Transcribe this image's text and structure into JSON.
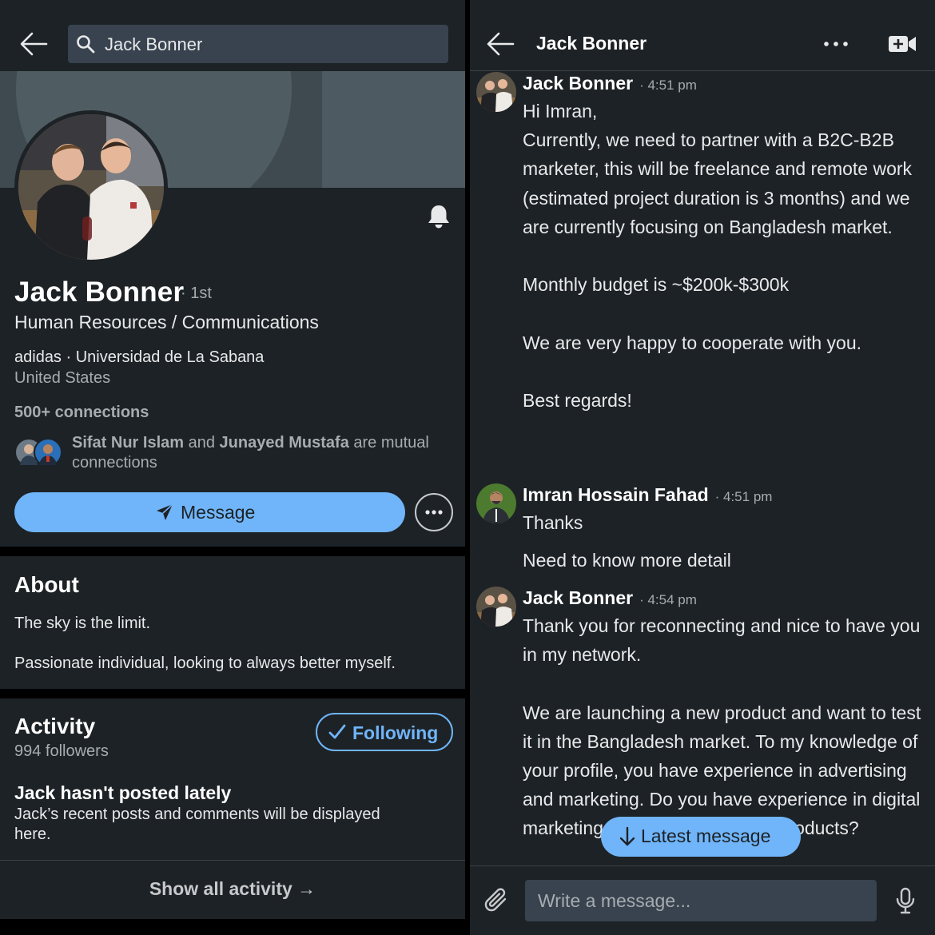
{
  "profile_screen": {
    "search": {
      "value": "Jack Bonner"
    },
    "name": "Jack Bonner",
    "degree": "· 1st",
    "headline": "Human Resources / Communications",
    "company_line": "adidas · Universidad de La Sabana",
    "location": "United States",
    "connections": "500+ connections",
    "mutual": {
      "person1": "Sifat Nur Islam",
      "and": "and",
      "person2": "Junayed Mustafa",
      "suffix": "are mutual connections"
    },
    "message_button": "Message",
    "about": {
      "title": "About",
      "line1": "The sky is the limit.",
      "line2": "Passionate individual, looking to always better myself."
    },
    "activity": {
      "title": "Activity",
      "followers": "994 followers",
      "following_button": "Following",
      "empty_title": "Jack hasn't posted lately",
      "empty_desc": "Jack’s recent posts and comments will be displayed here.",
      "show_all": "Show all activity →"
    }
  },
  "messaging_screen": {
    "title": "Jack Bonner",
    "messages": [
      {
        "sender": "Jack Bonner",
        "time": "· 4:51 pm",
        "paragraphs": [
          "Hi Imran,",
          "Currently, we need to partner with a B2C-B2B marketer, this will be freelance and remote work (estimated project duration is 3 months) and we are currently focusing on Bangladesh market.",
          "Monthly budget is ~$200k-$300k",
          "We are very happy to cooperate with you.",
          "Best regards!"
        ]
      },
      {
        "sender": "Imran Hossain Fahad",
        "time": "· 4:51 pm",
        "paragraphs": [
          "Thanks",
          "Need to know more detail"
        ]
      },
      {
        "sender": "Jack Bonner",
        "time": "· 4:54 pm",
        "paragraphs": [
          "Thank you for reconnecting and nice to have you in my network.",
          "We are launching a new product and want to test it in the Bangladesh market. To my knowledge of your profile, you have experience in advertising and marketing. Do you have experience in digital marketing for branded Fashion products?"
        ]
      }
    ],
    "latest_message_button": "Latest message",
    "compose_placeholder": "Write a message..."
  },
  "colors": {
    "background": "#1d2226",
    "accent_blue": "#70b5f9",
    "input_bg": "#38434f",
    "muted_text": "#a7acb0"
  },
  "icons": [
    "back-arrow-icon",
    "search-icon",
    "bell-icon",
    "send-icon",
    "more-icon",
    "check-icon",
    "arrow-right-icon",
    "ellipsis-icon",
    "video-call-icon",
    "arrow-down-icon",
    "paperclip-icon",
    "microphone-icon"
  ]
}
